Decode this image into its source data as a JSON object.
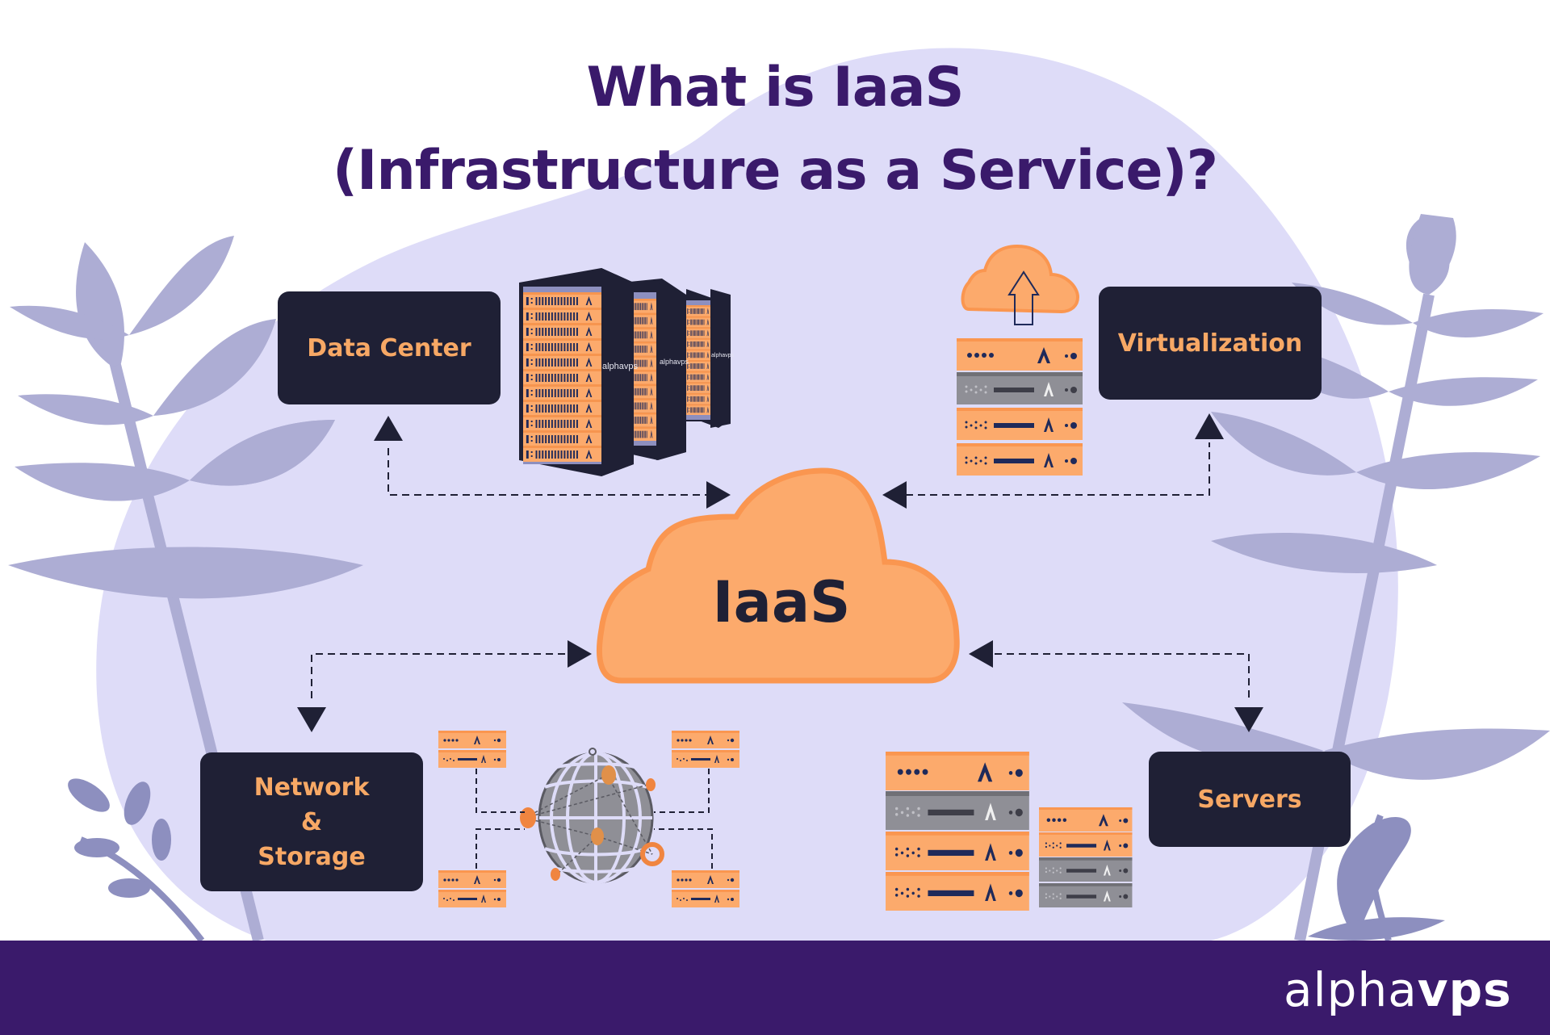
{
  "title": {
    "line1": "What is IaaS",
    "line2": "(Infrastructure as a Service)?"
  },
  "center": {
    "label": "IaaS",
    "icon": "cloud-icon"
  },
  "nodes": [
    {
      "id": "data-center",
      "label": "Data Center",
      "illustration": "server-racks-icon"
    },
    {
      "id": "virtualization",
      "label": "Virtualization",
      "illustration": "cloud-upload-server-stack-icon"
    },
    {
      "id": "network-storage",
      "label_lines": [
        "Network",
        "&",
        "Storage"
      ],
      "illustration": "globe-network-icon"
    },
    {
      "id": "servers",
      "label": "Servers",
      "illustration": "server-stack-icon"
    }
  ],
  "rack_brand": "alphavps",
  "footer": {
    "logo_prefix": "alpha",
    "logo_suffix": "vps",
    "logo_icon": "alphavps-logo-icon"
  },
  "colors": {
    "title": "#3a1a6b",
    "footer": "#3a1a6b",
    "box": "#1f2035",
    "box_text": "#f7a865",
    "cloud": "#fcaa6c",
    "cloud_stroke": "#fa9650",
    "blob": "#dedcf8",
    "leaf": "#adadd4",
    "leaf_dark": "#8d8fbf",
    "server_gray": "#8f8f96"
  }
}
